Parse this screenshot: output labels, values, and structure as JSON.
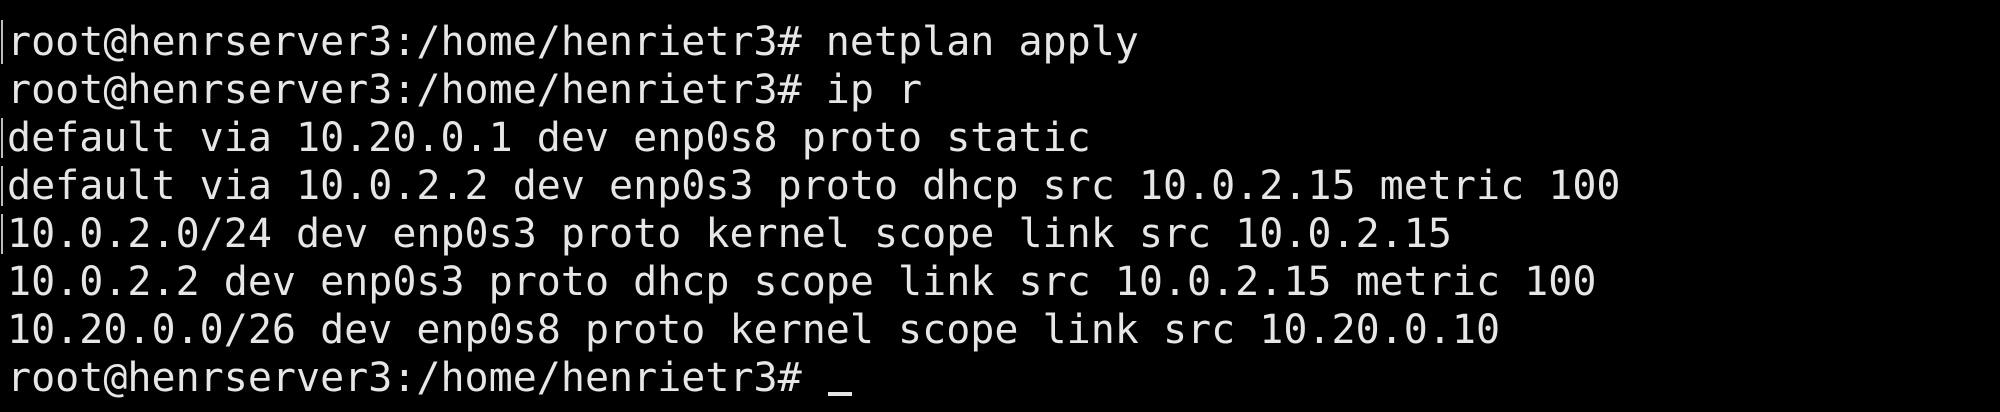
{
  "terminal": {
    "prompt": "root@henrserver3:/home/henrietr3# ",
    "lines": [
      {
        "type": "command",
        "text": "netplan apply"
      },
      {
        "type": "command",
        "text": "ip r"
      },
      {
        "type": "output",
        "text": "default via 10.20.0.1 dev enp0s8 proto static"
      },
      {
        "type": "output",
        "text": "default via 10.0.2.2 dev enp0s3 proto dhcp src 10.0.2.15 metric 100"
      },
      {
        "type": "output",
        "text": "10.0.2.0/24 dev enp0s3 proto kernel scope link src 10.0.2.15"
      },
      {
        "type": "output",
        "text": "10.0.2.2 dev enp0s3 proto dhcp scope link src 10.0.2.15 metric 100"
      },
      {
        "type": "output",
        "text": "10.20.0.0/26 dev enp0s8 proto kernel scope link src 10.20.0.10"
      }
    ],
    "current_input": ""
  },
  "colors": {
    "background": "#000000",
    "foreground": "#e6e6e6"
  }
}
